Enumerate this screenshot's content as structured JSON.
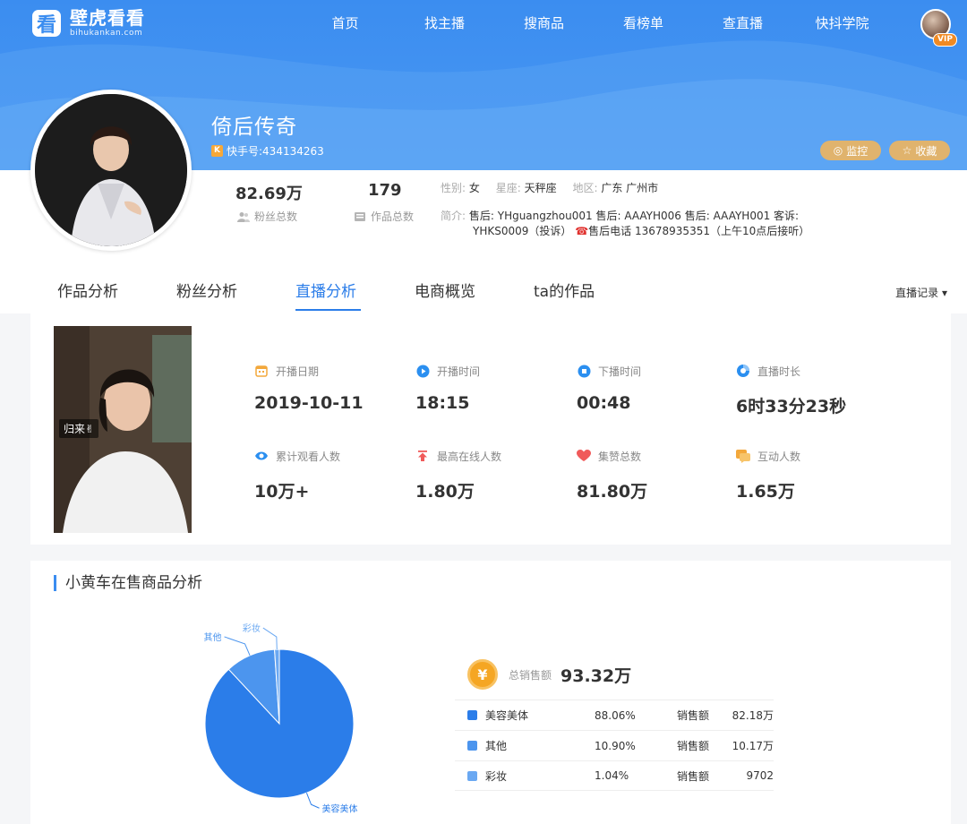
{
  "brand": {
    "title": "壁虎看看",
    "subtitle": "bihukankan.com"
  },
  "nav": [
    "首页",
    "找主播",
    "搜商品",
    "看榜单",
    "查直播",
    "快抖学院"
  ],
  "user": {
    "vip_label": "VIP"
  },
  "profile": {
    "name": "倚后传奇",
    "ks_id": "快手号:434134263",
    "fans_value": "82.69万",
    "fans_label": "粉丝总数",
    "works_value": "179",
    "works_label": "作品总数",
    "gender_label": "性别:",
    "gender": "女",
    "zodiac_label": "星座:",
    "zodiac": "天秤座",
    "region_label": "地区:",
    "region": "广东 广州市",
    "intro_label": "简介:",
    "intro_line1": "售后: YHguangzhou001 售后: AAAYH006 售后: AAAYH001 客诉:",
    "intro_line2a": "YHKS0009（投诉）",
    "intro_line2b": "售后电话 13678935351（上午10点后接听）",
    "monitor_label": "监控",
    "favorite_label": "收藏"
  },
  "tabs": [
    "作品分析",
    "粉丝分析",
    "直播分析",
    "电商概览",
    "ta的作品"
  ],
  "active_tab": "直播分析",
  "live_record_label": "直播记录",
  "live": {
    "photo_tag": "归来✌",
    "metrics": [
      {
        "label": "开播日期",
        "value": "2019-10-11",
        "icon": "calendar-icon",
        "color": "#f3a83b"
      },
      {
        "label": "开播时间",
        "value": "18:15",
        "icon": "play-icon",
        "color": "#2b8ff0"
      },
      {
        "label": "下播时间",
        "value": "00:48",
        "icon": "stop-icon",
        "color": "#2b8ff0"
      },
      {
        "label": "直播时长",
        "value": "6时33分23秒",
        "icon": "clock-icon",
        "color": "#2b8ff0"
      },
      {
        "label": "累计观看人数",
        "value": "10万+",
        "icon": "eye-icon",
        "color": "#2b8ff0"
      },
      {
        "label": "最高在线人数",
        "value": "1.80万",
        "icon": "arrow-up-icon",
        "color": "#f05a5a"
      },
      {
        "label": "集赞总数",
        "value": "81.80万",
        "icon": "heart-icon",
        "color": "#f05a5a"
      },
      {
        "label": "互动人数",
        "value": "1.65万",
        "icon": "chat-icon",
        "color": "#f3a83b"
      }
    ]
  },
  "goods": {
    "title": "小黄车在售商品分析",
    "total_label": "总销售额",
    "total_value": "93.32万",
    "coin_symbol": "¥",
    "sales_label": "销售额",
    "rows": [
      {
        "name": "美容美体",
        "pct": "88.06%",
        "value": "82.18万",
        "color": "#2b7de9"
      },
      {
        "name": "其他",
        "pct": "10.90%",
        "value": "10.17万",
        "color": "#4c95ee"
      },
      {
        "name": "彩妆",
        "pct": "1.04%",
        "value": "9702",
        "color": "#6aa8f2"
      }
    ]
  },
  "chart_data": {
    "type": "pie",
    "categories": [
      "美容美体",
      "其他",
      "彩妆"
    ],
    "values": [
      88.06,
      10.9,
      1.04
    ],
    "colors": [
      "#2b7de9",
      "#4c95ee",
      "#6aa8f2"
    ]
  }
}
